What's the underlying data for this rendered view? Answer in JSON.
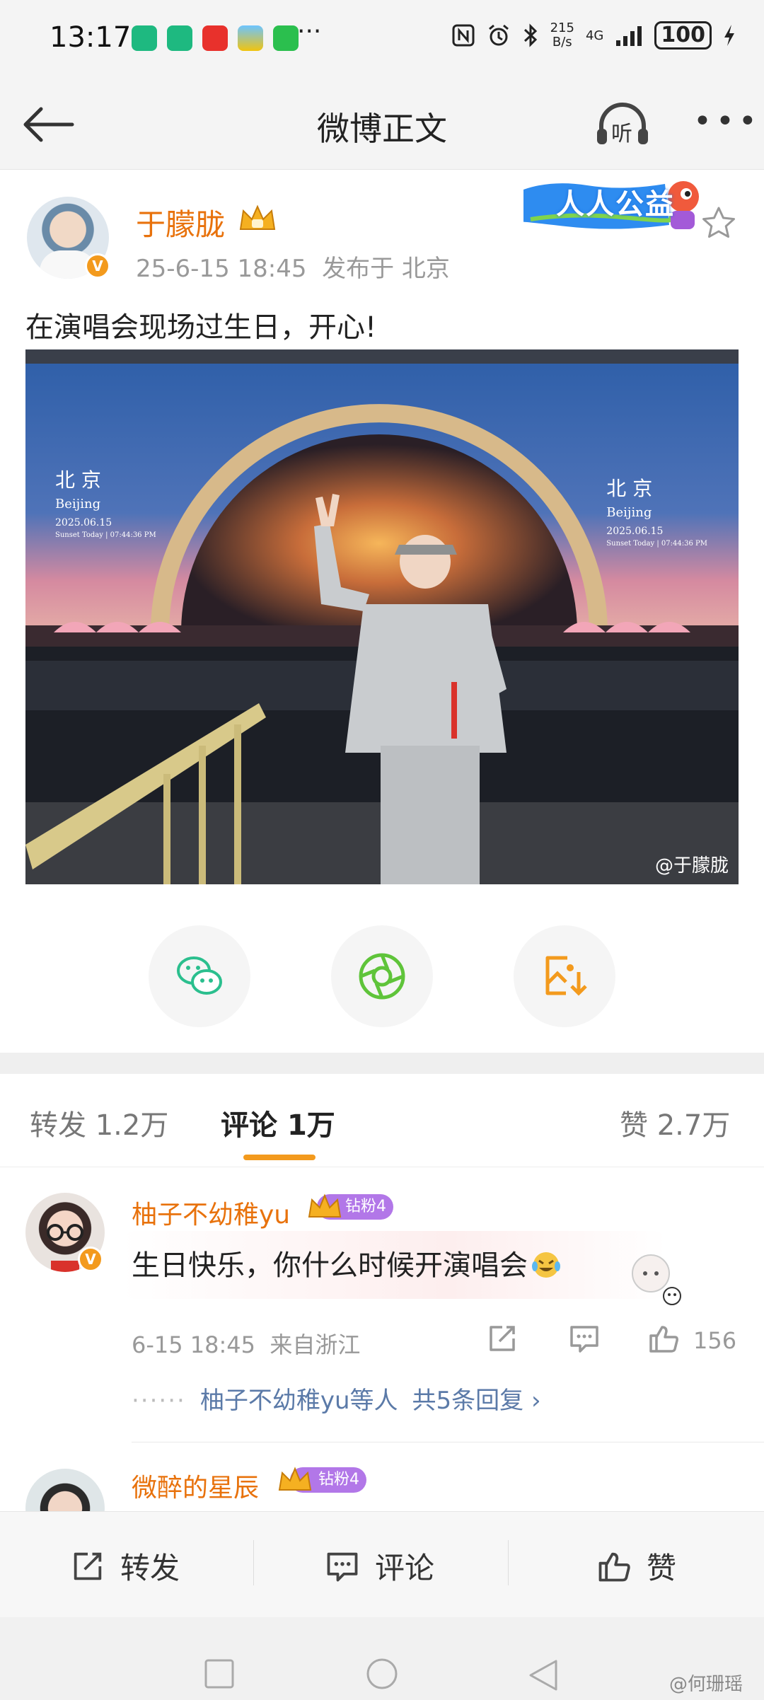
{
  "status_bar": {
    "time": "13:17",
    "more": "···",
    "net_speed": "215\nB/s",
    "signal": "4G",
    "battery": "100"
  },
  "nav": {
    "title": "微博正文",
    "listen_label": "听"
  },
  "post": {
    "author": "于朦胧",
    "timestamp": "25-6-15 18:45",
    "location": "发布于 北京",
    "text": "在演唱会现场过生日，开心!",
    "charity_label": "人人公益",
    "image": {
      "city_cn": "北 京",
      "city_en": "Beijing",
      "date": "2025.06.15",
      "sunset": "Sunset Today | 07:44:36 PM",
      "watermark": "@于朦胧"
    }
  },
  "tabs": [
    {
      "label": "转发",
      "count": "1.2万"
    },
    {
      "label": "评论",
      "count": "1万"
    },
    {
      "label": "赞",
      "count": "2.7万"
    }
  ],
  "comments": [
    {
      "name": "柚子不幼稚yu",
      "fan_badge": "钻粉4",
      "text": "生日快乐，你什么时候开演唱会",
      "time": "6-15 18:45",
      "source": "来自浙江",
      "likes": "156",
      "replies_users": "柚子不幼稚yu等人",
      "replies_total": "共5条回复",
      "replies_arrow": "›"
    },
    {
      "name": "微醉的星辰",
      "fan_badge": "钻粉4"
    }
  ],
  "bottom_bar": {
    "repost": "转发",
    "comment": "评论",
    "like": "赞"
  },
  "credit": "@何珊瑶",
  "colors": {
    "accent_orange": "#e8720c",
    "tab_underline": "#f39a1d",
    "link_blue": "#5b7aa8",
    "fan_badge_purple": "#b277e8"
  }
}
